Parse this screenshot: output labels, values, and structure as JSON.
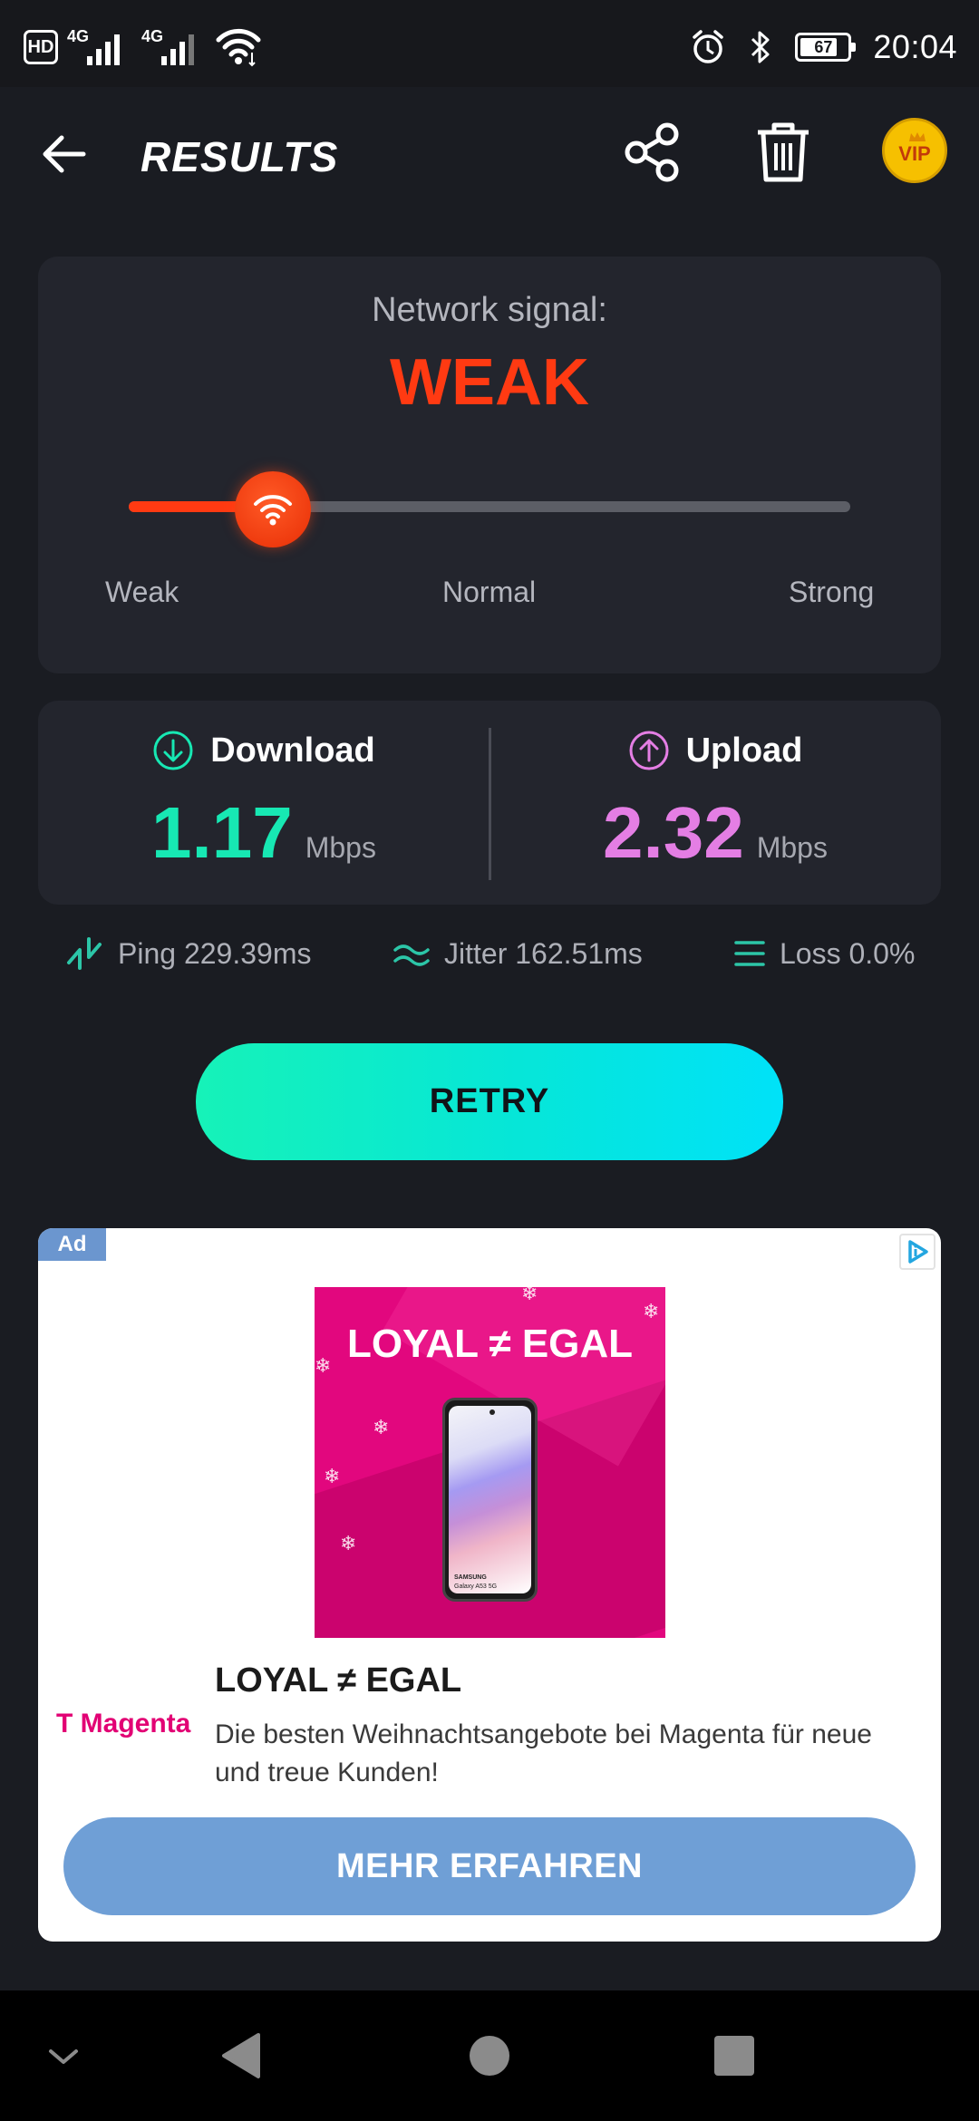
{
  "status_bar": {
    "hd": "HD",
    "sim1": "4G",
    "sim2": "4G",
    "battery": "67",
    "time": "20:04"
  },
  "header": {
    "title": "RESULTS",
    "vip": "VIP"
  },
  "signal": {
    "label": "Network signal:",
    "value": "WEAK",
    "level": 0.2,
    "scale": [
      "Weak",
      "Normal",
      "Strong"
    ],
    "accent": "#ff3a12"
  },
  "speed": {
    "download": {
      "label": "Download",
      "value": "1.17",
      "unit": "Mbps",
      "color": "#17e8b3"
    },
    "upload": {
      "label": "Upload",
      "value": "2.32",
      "unit": "Mbps",
      "color": "#e47ee4"
    }
  },
  "metrics": {
    "ping": "Ping 229.39ms",
    "jitter": "Jitter 162.51ms",
    "loss": "Loss 0.0%"
  },
  "retry_label": "RETRY",
  "ad": {
    "badge": "Ad",
    "image_headline": "LOYAL ≠ EGAL",
    "phone_brand": "SAMSUNG",
    "phone_model": "Galaxy A53 5G",
    "advertiser": "Magenta",
    "title": "LOYAL ≠ EGAL",
    "description": "Die besten Weihnachtsangebote bei Magenta für neue und treue Kunden!",
    "cta": "MEHR ERFAHREN"
  }
}
